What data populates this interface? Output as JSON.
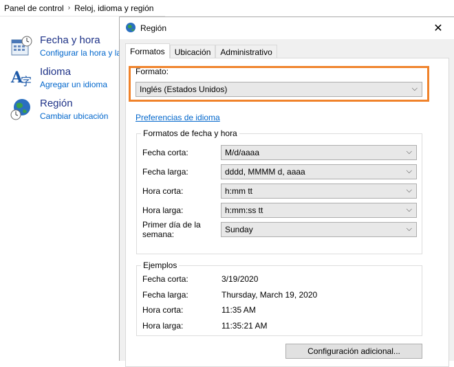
{
  "breadcrumb": {
    "items": [
      "Panel de control",
      "Reloj, idioma y región"
    ]
  },
  "control_panel": {
    "items": [
      {
        "title": "Fecha y hora",
        "link": "Configurar la hora y la"
      },
      {
        "title": "Idioma",
        "link": "Agregar un idioma"
      },
      {
        "title": "Región",
        "link": "Cambiar ubicación"
      }
    ]
  },
  "dialog": {
    "title": "Región",
    "close": "✕",
    "tabs": [
      "Formatos",
      "Ubicación",
      "Administrativo"
    ],
    "format_label": "Formato:",
    "format_value": "Inglés (Estados Unidos)",
    "language_prefs_link": "Preferencias de idioma",
    "date_time_group": {
      "title": "Formatos de fecha y hora",
      "rows": [
        {
          "label": "Fecha corta:",
          "value": "M/d/aaaa"
        },
        {
          "label": "Fecha larga:",
          "value": "dddd, MMMM d, aaaa"
        },
        {
          "label": "Hora corta:",
          "value": "h:mm tt"
        },
        {
          "label": "Hora larga:",
          "value": "h:mm:ss tt"
        },
        {
          "label": "Primer día de la semana:",
          "label_line1": "Primer día de la",
          "label_line2": "semana:",
          "value": "Sunday"
        }
      ]
    },
    "examples_group": {
      "title": "Ejemplos",
      "rows": [
        {
          "label": "Fecha corta:",
          "value": "3/19/2020"
        },
        {
          "label": "Fecha larga:",
          "value": "Thursday, March 19, 2020"
        },
        {
          "label": "Hora corta:",
          "value": "11:35 AM"
        },
        {
          "label": "Hora larga:",
          "value": "11:35:21 AM"
        }
      ]
    },
    "additional_settings_button": "Configuración adicional..."
  },
  "colors": {
    "highlight": "#f0822a",
    "link": "#0066cc",
    "heading": "#1e3287"
  }
}
